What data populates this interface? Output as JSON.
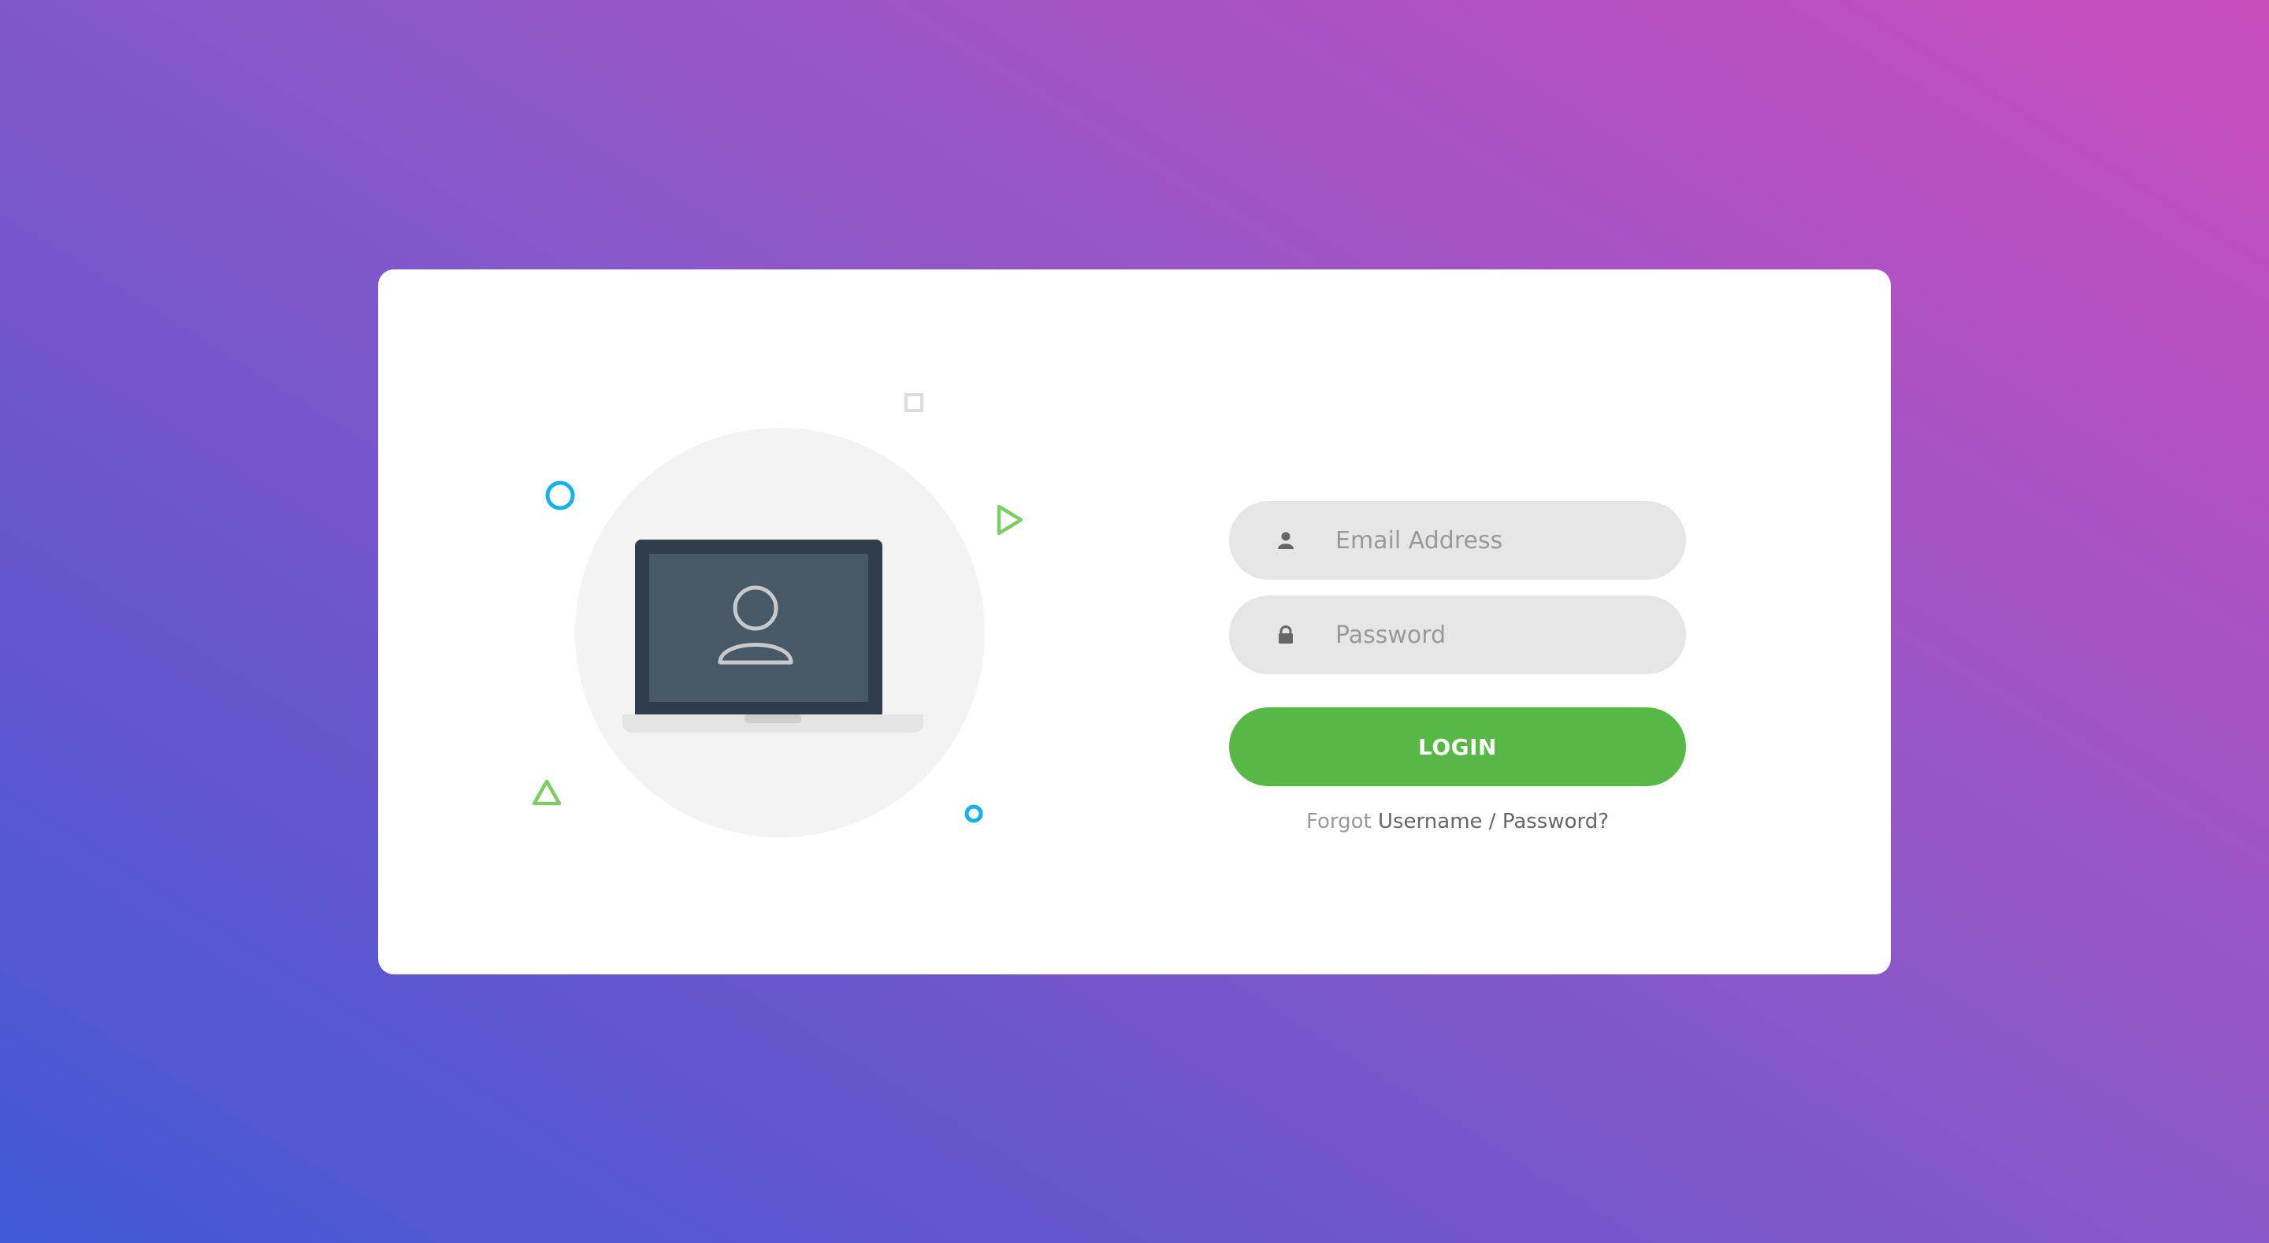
{
  "login_form": {
    "email_placeholder": "Email Address",
    "password_placeholder": "Password",
    "login_label": "LOGIN",
    "forgot_prefix": "Forgot",
    "forgot_link": "Username / Password?"
  },
  "icons": {
    "email_field_icon": "user-icon",
    "password_field_icon": "lock-icon",
    "illustration": "laptop-user-icon"
  },
  "colors": {
    "login_button": "#57b846",
    "field_background": "#e6e6e6",
    "placeholder_text": "#999999",
    "deco_blue": "#17b1e6",
    "deco_green": "#7ccd63",
    "background_gradient": [
      "#4159d6",
      "#8c58c8",
      "#c94dbd"
    ]
  }
}
